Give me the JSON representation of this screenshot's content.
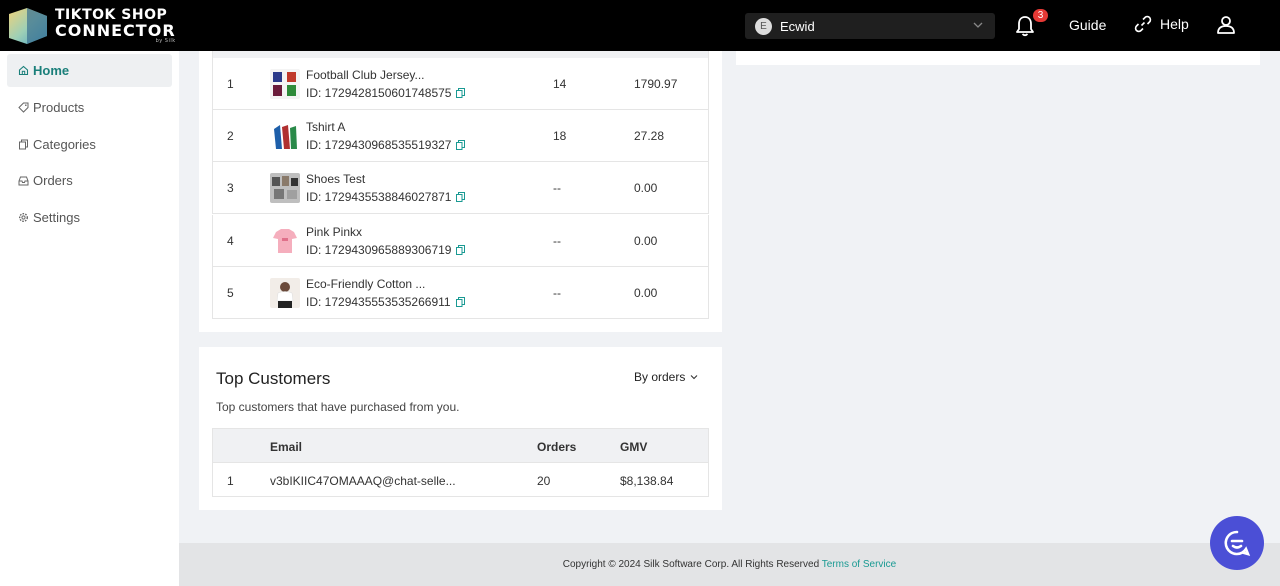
{
  "header": {
    "logo_line1": "TIKTOK SHOP",
    "logo_line2": "CONNECTOR",
    "logo_line3": "by Silk",
    "store_initial": "E",
    "store_name": "Ecwid",
    "notification_count": "3",
    "guide_label": "Guide",
    "help_label": "Help"
  },
  "sidebar": {
    "items": [
      {
        "label": "Home",
        "icon": "home-icon",
        "active": true
      },
      {
        "label": "Products",
        "icon": "tag-icon"
      },
      {
        "label": "Categories",
        "icon": "copy-icon"
      },
      {
        "label": "Orders",
        "icon": "inbox-icon"
      },
      {
        "label": "Settings",
        "icon": "gear-icon"
      }
    ]
  },
  "top_products": {
    "rows": [
      {
        "rank": "1",
        "name": "Football Club Jersey...",
        "id": "ID: 1729428150601748575",
        "qty": "14",
        "gmv": "1790.97"
      },
      {
        "rank": "2",
        "name": "Tshirt A",
        "id": "ID: 1729430968535519327",
        "qty": "18",
        "gmv": "27.28"
      },
      {
        "rank": "3",
        "name": "Shoes Test",
        "id": "ID: 1729435538846027871",
        "qty": "--",
        "gmv": "0.00"
      },
      {
        "rank": "4",
        "name": "Pink Pinkx",
        "id": "ID: 1729430965889306719",
        "qty": "--",
        "gmv": "0.00"
      },
      {
        "rank": "5",
        "name": "Eco-Friendly Cotton ...",
        "id": "ID: 1729435553535266911",
        "qty": "--",
        "gmv": "0.00"
      }
    ]
  },
  "top_customers": {
    "title": "Top Customers",
    "sort_label": "By orders",
    "subtitle": "Top customers that have purchased from you.",
    "columns": {
      "email": "Email",
      "orders": "Orders",
      "gmv": "GMV"
    },
    "rows": [
      {
        "rank": "1",
        "email": "v3bIKIIC47OMAAAQ@chat-selle...",
        "orders": "20",
        "gmv": "$8,138.84"
      }
    ]
  },
  "footer": {
    "copyright": "Copyright © 2024 Silk Software Corp. All Rights Reserved",
    "terms_link": "Terms of Service"
  },
  "colors": {
    "accent": "#1a7f7a",
    "badge": "#e53935",
    "chat": "#4b4fd6"
  }
}
